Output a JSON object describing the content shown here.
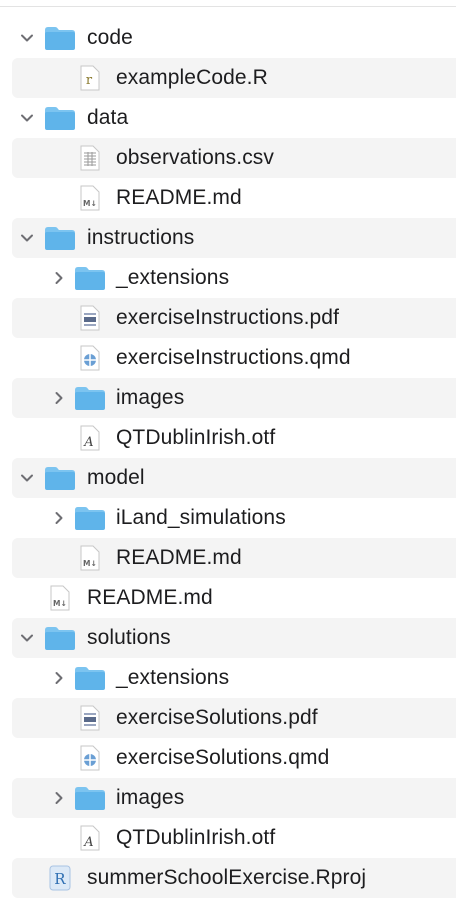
{
  "colors": {
    "folder": "#5fb4ea",
    "folder_tab": "#7cc4f0",
    "row_alt": "#f4f4f4",
    "chevron": "#6e6e73"
  },
  "rows": [
    {
      "label": "code",
      "type": "folder",
      "depth": 0,
      "expanded": true,
      "icon": "folder-icon"
    },
    {
      "label": "exampleCode.R",
      "type": "file",
      "depth": 1,
      "icon": "r-script-icon"
    },
    {
      "label": "data",
      "type": "folder",
      "depth": 0,
      "expanded": true,
      "icon": "folder-icon"
    },
    {
      "label": "observations.csv",
      "type": "file",
      "depth": 1,
      "icon": "csv-icon"
    },
    {
      "label": "README.md",
      "type": "file",
      "depth": 1,
      "icon": "markdown-icon"
    },
    {
      "label": "instructions",
      "type": "folder",
      "depth": 0,
      "expanded": true,
      "icon": "folder-icon"
    },
    {
      "label": "_extensions",
      "type": "folder",
      "depth": 1,
      "expanded": false,
      "icon": "folder-icon"
    },
    {
      "label": "exerciseInstructions.pdf",
      "type": "file",
      "depth": 1,
      "icon": "pdf-icon"
    },
    {
      "label": "exerciseInstructions.qmd",
      "type": "file",
      "depth": 1,
      "icon": "quarto-icon"
    },
    {
      "label": "images",
      "type": "folder",
      "depth": 1,
      "expanded": false,
      "icon": "folder-icon"
    },
    {
      "label": "QTDublinIrish.otf",
      "type": "file",
      "depth": 1,
      "icon": "font-icon"
    },
    {
      "label": "model",
      "type": "folder",
      "depth": 0,
      "expanded": true,
      "icon": "folder-icon"
    },
    {
      "label": "iLand_simulations",
      "type": "folder",
      "depth": 1,
      "expanded": false,
      "icon": "folder-icon"
    },
    {
      "label": "README.md",
      "type": "file",
      "depth": 1,
      "icon": "markdown-icon"
    },
    {
      "label": "README.md",
      "type": "file",
      "depth": "root",
      "icon": "markdown-icon"
    },
    {
      "label": "solutions",
      "type": "folder",
      "depth": 0,
      "expanded": true,
      "icon": "folder-icon"
    },
    {
      "label": "_extensions",
      "type": "folder",
      "depth": 1,
      "expanded": false,
      "icon": "folder-icon"
    },
    {
      "label": "exerciseSolutions.pdf",
      "type": "file",
      "depth": 1,
      "icon": "pdf-icon"
    },
    {
      "label": "exerciseSolutions.qmd",
      "type": "file",
      "depth": 1,
      "icon": "quarto-icon"
    },
    {
      "label": "images",
      "type": "folder",
      "depth": 1,
      "expanded": false,
      "icon": "folder-icon"
    },
    {
      "label": "QTDublinIrish.otf",
      "type": "file",
      "depth": 1,
      "icon": "font-icon"
    },
    {
      "label": "summerSchoolExercise.Rproj",
      "type": "file",
      "depth": "root",
      "icon": "rproj-icon"
    }
  ],
  "icon_glyphs": {
    "r_script": "r",
    "markdown": "M↓",
    "font": "A",
    "rproj": "R"
  }
}
